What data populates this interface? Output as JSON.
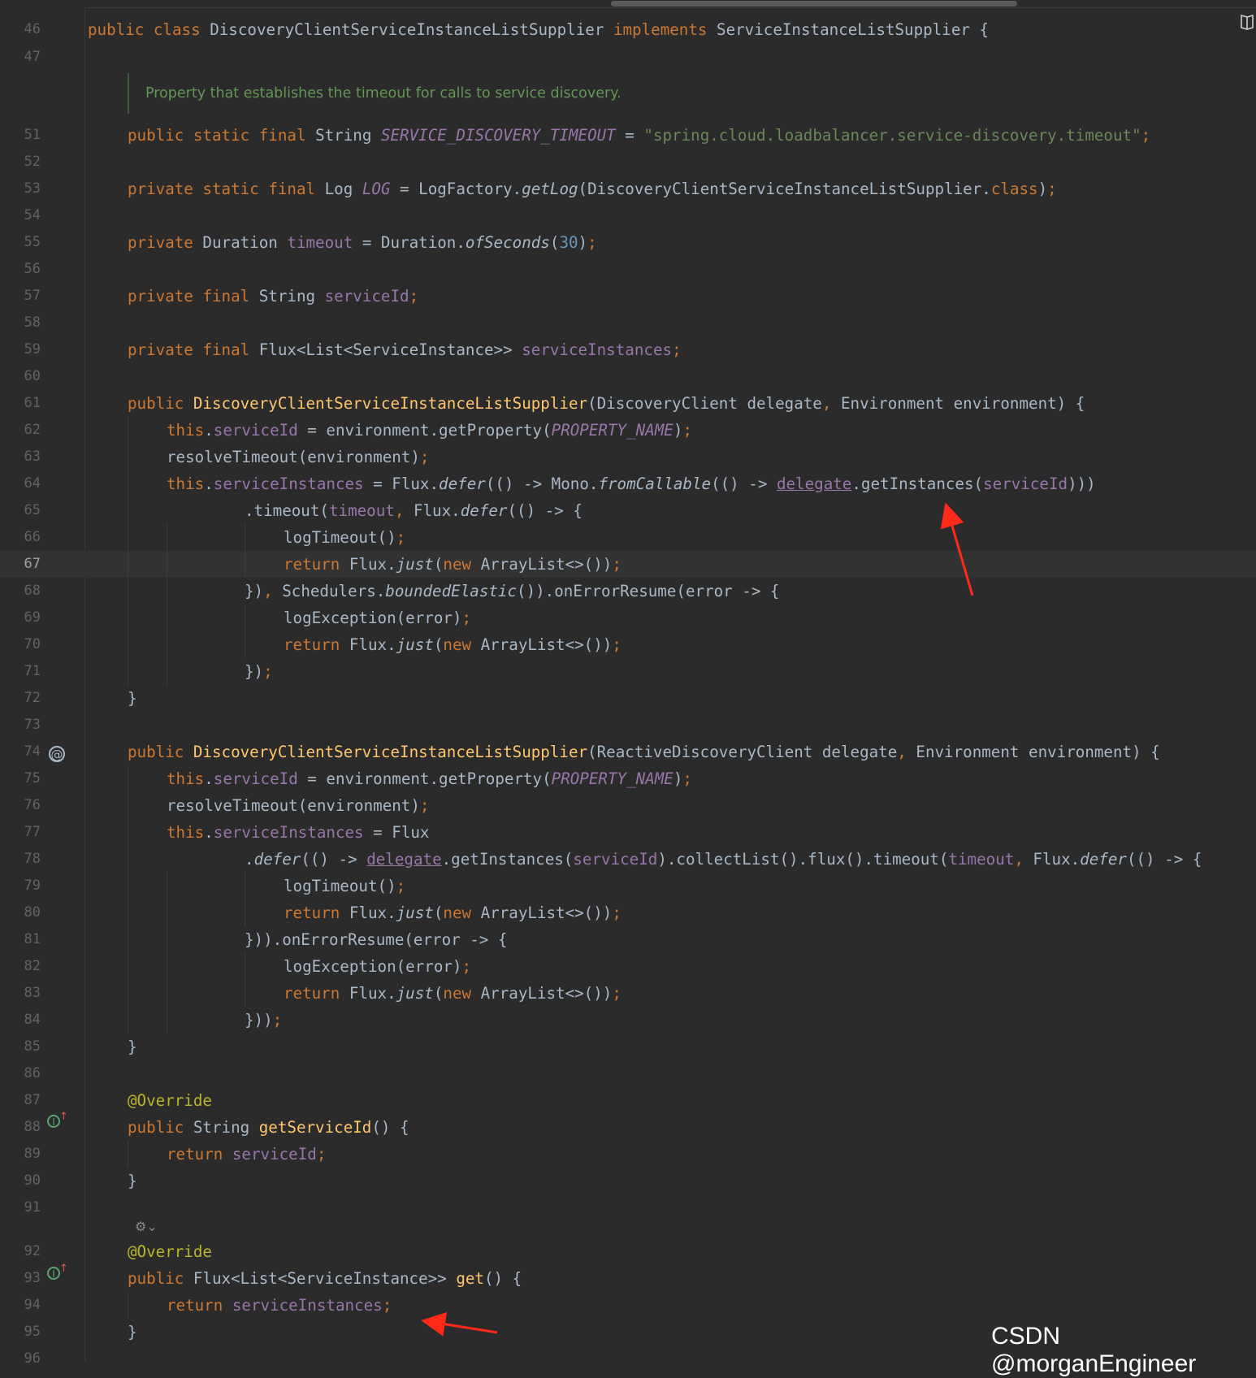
{
  "editor": {
    "doc_comment": "Property that establishes the timeout for calls to service discovery.",
    "current_line": "67",
    "fold_hint": "⚙⌄",
    "lines": [
      {
        "n": "46",
        "code": "public class DiscoveryClientServiceInstanceListSupplier implements ServiceInstanceListSupplier {"
      },
      {
        "n": "47",
        "code": ""
      },
      {
        "n": "51",
        "code": "public static final String SERVICE_DISCOVERY_TIMEOUT = \"spring.cloud.loadbalancer.service-discovery.timeout\";"
      },
      {
        "n": "52",
        "code": ""
      },
      {
        "n": "53",
        "code": "private static final Log LOG = LogFactory.getLog(DiscoveryClientServiceInstanceListSupplier.class);"
      },
      {
        "n": "54",
        "code": ""
      },
      {
        "n": "55",
        "code": "private Duration timeout = Duration.ofSeconds(30);"
      },
      {
        "n": "56",
        "code": ""
      },
      {
        "n": "57",
        "code": "private final String serviceId;"
      },
      {
        "n": "58",
        "code": ""
      },
      {
        "n": "59",
        "code": "private final Flux<List<ServiceInstance>> serviceInstances;"
      },
      {
        "n": "60",
        "code": ""
      },
      {
        "n": "61",
        "code": "public DiscoveryClientServiceInstanceListSupplier(DiscoveryClient delegate, Environment environment) {"
      },
      {
        "n": "62",
        "code": "this.serviceId = environment.getProperty(PROPERTY_NAME);"
      },
      {
        "n": "63",
        "code": "resolveTimeout(environment);"
      },
      {
        "n": "64",
        "code": "this.serviceInstances = Flux.defer(() -> Mono.fromCallable(() -> delegate.getInstances(serviceId)))"
      },
      {
        "n": "65",
        "code": ".timeout(timeout, Flux.defer(() -> {"
      },
      {
        "n": "66",
        "code": "logTimeout();"
      },
      {
        "n": "67",
        "code": "return Flux.just(new ArrayList<>());"
      },
      {
        "n": "68",
        "code": "}), Schedulers.boundedElastic()).onErrorResume(error -> {"
      },
      {
        "n": "69",
        "code": "logException(error);"
      },
      {
        "n": "70",
        "code": "return Flux.just(new ArrayList<>());"
      },
      {
        "n": "71",
        "code": "});"
      },
      {
        "n": "72",
        "code": "}"
      },
      {
        "n": "73",
        "code": ""
      },
      {
        "n": "74",
        "code": "public DiscoveryClientServiceInstanceListSupplier(ReactiveDiscoveryClient delegate, Environment environment) {"
      },
      {
        "n": "75",
        "code": "this.serviceId = environment.getProperty(PROPERTY_NAME);"
      },
      {
        "n": "76",
        "code": "resolveTimeout(environment);"
      },
      {
        "n": "77",
        "code": "this.serviceInstances = Flux"
      },
      {
        "n": "78",
        "code": ".defer(() -> delegate.getInstances(serviceId).collectList().flux().timeout(timeout, Flux.defer(() -> {"
      },
      {
        "n": "79",
        "code": "logTimeout();"
      },
      {
        "n": "80",
        "code": "return Flux.just(new ArrayList<>());"
      },
      {
        "n": "81",
        "code": "})).onErrorResume(error -> {"
      },
      {
        "n": "82",
        "code": "logException(error);"
      },
      {
        "n": "83",
        "code": "return Flux.just(new ArrayList<>());"
      },
      {
        "n": "84",
        "code": "}));"
      },
      {
        "n": "85",
        "code": "}"
      },
      {
        "n": "86",
        "code": ""
      },
      {
        "n": "87",
        "code": "@Override"
      },
      {
        "n": "88",
        "code": "public String getServiceId() {"
      },
      {
        "n": "89",
        "code": "return serviceId;"
      },
      {
        "n": "90",
        "code": "}"
      },
      {
        "n": "91",
        "code": ""
      },
      {
        "n": "92",
        "code": "@Override"
      },
      {
        "n": "93",
        "code": "public Flux<List<ServiceInstance>> get() {"
      },
      {
        "n": "94",
        "code": "return serviceInstances;"
      },
      {
        "n": "95",
        "code": "}"
      },
      {
        "n": "96",
        "code": ""
      }
    ]
  },
  "gutter_icons": {
    "at_symbol": "@",
    "implements_glyph": "I",
    "implements_arrow": "↑"
  },
  "watermark": "CSDN @morganEngineer",
  "colors": {
    "background": "#2b2b2b",
    "keyword": "#cc7832",
    "field": "#9876aa",
    "string": "#6a8759",
    "number": "#6897bb",
    "method_decl": "#ffc66d",
    "annotation": "#bbb529",
    "comment": "#629755",
    "annotation_arrow": "#ff2a1a"
  }
}
